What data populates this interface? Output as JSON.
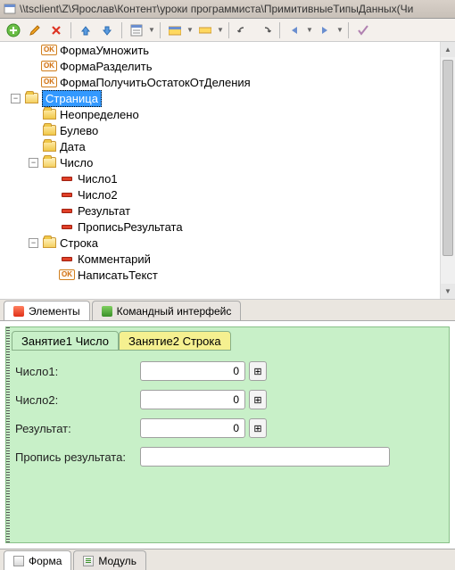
{
  "titlebar": {
    "path": "\\\\tsclient\\Z\\Ярослав\\Контент\\уроки программиста\\ПримитивныеТипыДанных(Чи"
  },
  "toolbar": {
    "add": "+",
    "edit": "✎",
    "delete": "✕",
    "up": "↑",
    "down": "↓"
  },
  "tree": {
    "items": [
      {
        "indent": 1,
        "icon": "ok",
        "label": "ФормаУмножить"
      },
      {
        "indent": 1,
        "icon": "ok",
        "label": "ФормаРазделить"
      },
      {
        "indent": 1,
        "icon": "ok",
        "label": "ФормаПолучитьОстатокОтДеления"
      },
      {
        "indent": 0,
        "toggle": "-",
        "icon": "folder-open",
        "label": "Страница",
        "selected": true
      },
      {
        "indent": 1,
        "icon": "folder",
        "label": "Неопределено"
      },
      {
        "indent": 1,
        "icon": "folder",
        "label": "Булево"
      },
      {
        "indent": 1,
        "icon": "folder",
        "label": "Дата"
      },
      {
        "indent": 1,
        "toggle": "-",
        "icon": "folder-open",
        "label": "Число"
      },
      {
        "indent": 2,
        "icon": "red",
        "label": "Число1"
      },
      {
        "indent": 2,
        "icon": "red",
        "label": "Число2"
      },
      {
        "indent": 2,
        "icon": "red",
        "label": "Результат"
      },
      {
        "indent": 2,
        "icon": "red",
        "label": "ПрописьРезультата"
      },
      {
        "indent": 1,
        "toggle": "-",
        "icon": "folder-open",
        "label": "Строка"
      },
      {
        "indent": 2,
        "icon": "red",
        "label": "Комментарий"
      },
      {
        "indent": 2,
        "icon": "ok",
        "label": "НаписатьТекст"
      }
    ]
  },
  "mid_tabs": {
    "t1": "Элементы",
    "t2": "Командный интерфейс"
  },
  "form": {
    "inner_tabs": {
      "t1": "Занятие1 Число",
      "t2": "Занятие2 Строка"
    },
    "fields": {
      "chislo1": {
        "label": "Число1:",
        "value": "0"
      },
      "chislo2": {
        "label": "Число2:",
        "value": "0"
      },
      "result": {
        "label": "Результат:",
        "value": "0"
      },
      "propis": {
        "label": "Пропись результата:",
        "value": ""
      }
    },
    "calc_glyph": "⊞"
  },
  "bottom_tabs": {
    "t1": "Форма",
    "t2": "Модуль"
  }
}
